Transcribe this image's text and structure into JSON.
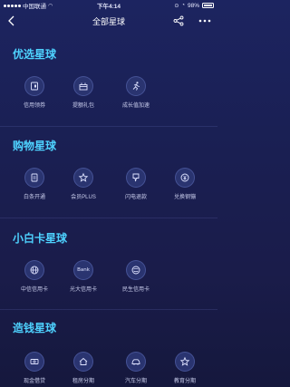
{
  "status_bar": {
    "carrier": "中国联通",
    "time": "下午4:14",
    "battery": "98%"
  },
  "nav": {
    "title": "全部星球"
  },
  "sections": [
    {
      "title": "优选星球",
      "items": [
        {
          "label": "信用领券"
        },
        {
          "label": "提额礼包"
        },
        {
          "label": "成长值加速"
        }
      ]
    },
    {
      "title": "购物星球",
      "items": [
        {
          "label": "白条开通"
        },
        {
          "label": "会员PLUS"
        },
        {
          "label": "闪电退款"
        },
        {
          "label": "兑换钢镚"
        }
      ]
    },
    {
      "title": "小白卡星球",
      "items": [
        {
          "label": "中信信用卡"
        },
        {
          "label": "光大信用卡",
          "icon_text": "Bank"
        },
        {
          "label": "民生信用卡"
        }
      ]
    },
    {
      "title": "造钱星球",
      "items": [
        {
          "label": "现金借贷"
        },
        {
          "label": "租房分期"
        },
        {
          "label": "汽车分期"
        },
        {
          "label": "教育分期"
        }
      ]
    }
  ],
  "colors": {
    "accent": "#4ed2ff",
    "background": "#1a1f52",
    "icon_circle": "#2a3470"
  }
}
